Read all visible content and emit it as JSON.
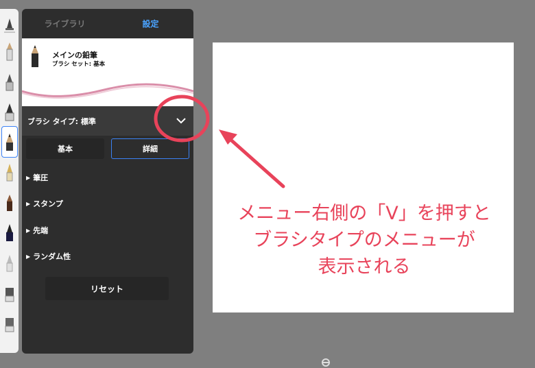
{
  "tabs": {
    "library": "ライブラリ",
    "settings": "設定"
  },
  "preview": {
    "brush_name": "メインの鉛筆",
    "brush_set": "ブラシ セット: 基本"
  },
  "brush_type": {
    "label": "ブラシ タイプ: 標準"
  },
  "mode_buttons": {
    "basic": "基本",
    "detail": "詳細"
  },
  "sections": [
    "筆圧",
    "スタンプ",
    "先端",
    "ランダム性"
  ],
  "reset_label": "リセット",
  "annotation": {
    "line1": "メニュー右側の「V」を押すと",
    "line2": "ブラシタイプのメニューが",
    "line3": "表示される",
    "color": "#e8435a"
  },
  "colors": {
    "accent": "#3b82f6",
    "active_tab": "#4aa3ff",
    "panel": "#2d2d2d"
  },
  "brush_tools": [
    "pen-icon",
    "pencil-icon",
    "ink-pen-icon",
    "brush-icon",
    "pencil-icon",
    "fountain-pen-icon",
    "marker-icon",
    "brush-icon",
    "pen-icon",
    "eraser-icon",
    "eraser-icon"
  ]
}
